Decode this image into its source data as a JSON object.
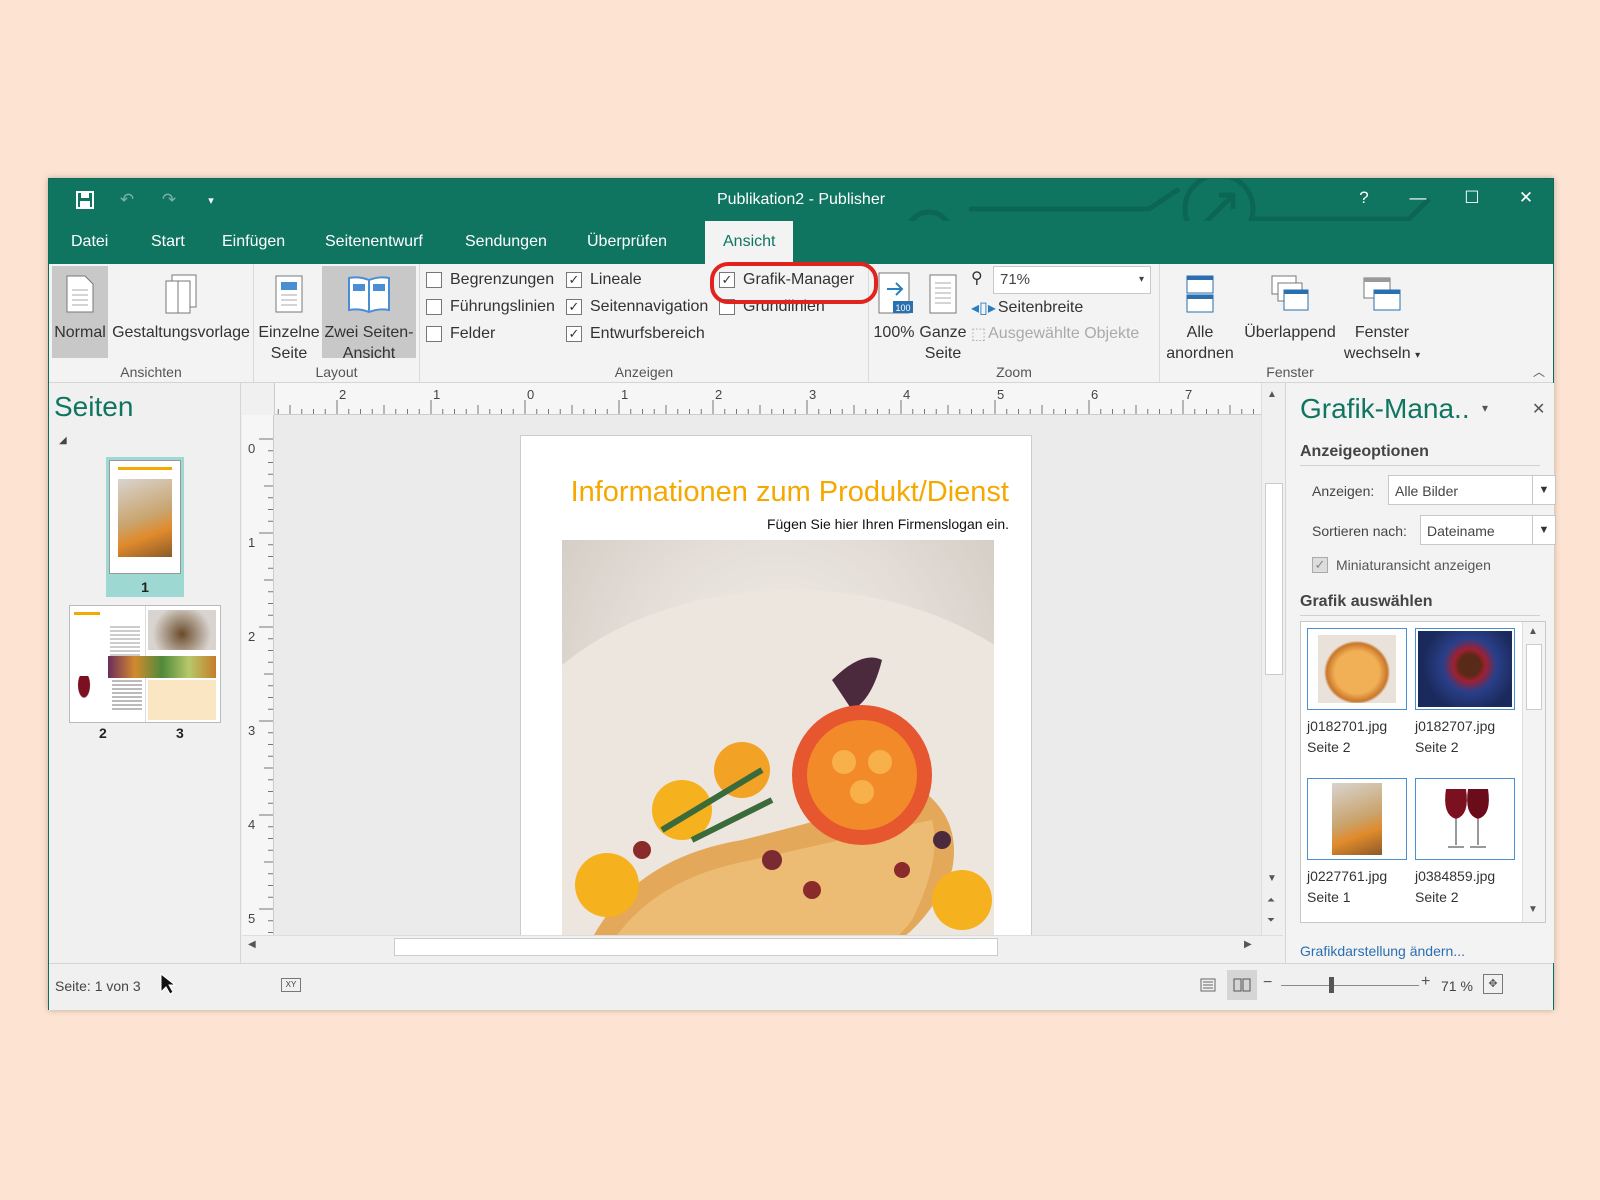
{
  "window": {
    "title": "Publikation2  -  Publisher",
    "help": "?",
    "minimize": "—",
    "maximize": "☐",
    "close": "✕"
  },
  "tabs": [
    "Datei",
    "Start",
    "Einfügen",
    "Seitenentwurf",
    "Sendungen",
    "Überprüfen",
    "Ansicht"
  ],
  "ribbon": {
    "ansichten": {
      "label": "Ansichten",
      "normal": "Normal",
      "gestaltung": "Gestaltungsvorlage"
    },
    "layout": {
      "label": "Layout",
      "einzelne_1": "Einzelne",
      "einzelne_2": "Seite",
      "zwei_1": "Zwei Seiten-",
      "zwei_2": "Ansicht"
    },
    "anzeigen": {
      "label": "Anzeigen",
      "begrenzungen": "Begrenzungen",
      "fuehrungslinien": "Führungslinien",
      "felder": "Felder",
      "lineale": "Lineale",
      "seitennavigation": "Seitennavigation",
      "entwurfsbereich": "Entwurfsbereich",
      "grafik_manager": "Grafik-Manager",
      "grundlinien": "Grundlinien"
    },
    "zoom": {
      "label": "Zoom",
      "hundert": "100%",
      "ganze_1": "Ganze",
      "ganze_2": "Seite",
      "value": "71%",
      "seitenbreite": "Seitenbreite",
      "ausgewaehlte": "Ausgewählte Objekte",
      "badge": "100"
    },
    "fenster": {
      "label": "Fenster",
      "alle_1": "Alle",
      "alle_2": "anordnen",
      "ueberlappend": "Überlappend",
      "wechseln_1": "Fenster",
      "wechseln_2": "wechseln"
    }
  },
  "pages_pane": {
    "title": "Seiten",
    "pages": [
      "1",
      "2",
      "3"
    ]
  },
  "document": {
    "headline": "Informationen zum Produkt/Dienst",
    "slogan": "Fügen Sie hier Ihren Firmenslogan ein."
  },
  "ruler": {
    "top": [
      "2",
      "1",
      "0",
      "1",
      "2",
      "3",
      "4",
      "5",
      "6",
      "7"
    ],
    "left": [
      "0",
      "1",
      "2",
      "3",
      "4",
      "5"
    ]
  },
  "task_pane": {
    "title": "Grafik-Mana..",
    "section1": "Anzeigeoptionen",
    "anzeigen_label": "Anzeigen:",
    "anzeigen_value": "Alle Bilder",
    "sortieren_label": "Sortieren nach:",
    "sortieren_value": "Dateiname",
    "miniatur": "Miniaturansicht anzeigen",
    "section2": "Grafik auswählen",
    "images": [
      {
        "name": "j0182701.jpg",
        "page": "Seite 2"
      },
      {
        "name": "j0182707.jpg",
        "page": "Seite 2"
      },
      {
        "name": "j0227761.jpg",
        "page": "Seite 1"
      },
      {
        "name": "j0384859.jpg",
        "page": "Seite 2"
      }
    ],
    "link": "Grafikdarstellung ändern..."
  },
  "status": {
    "page": "Seite: 1 von 3",
    "zoom": "71 %"
  },
  "colors": {
    "accent": "#0f7561",
    "highlight": "#e0231c",
    "headline": "#f5a800"
  }
}
